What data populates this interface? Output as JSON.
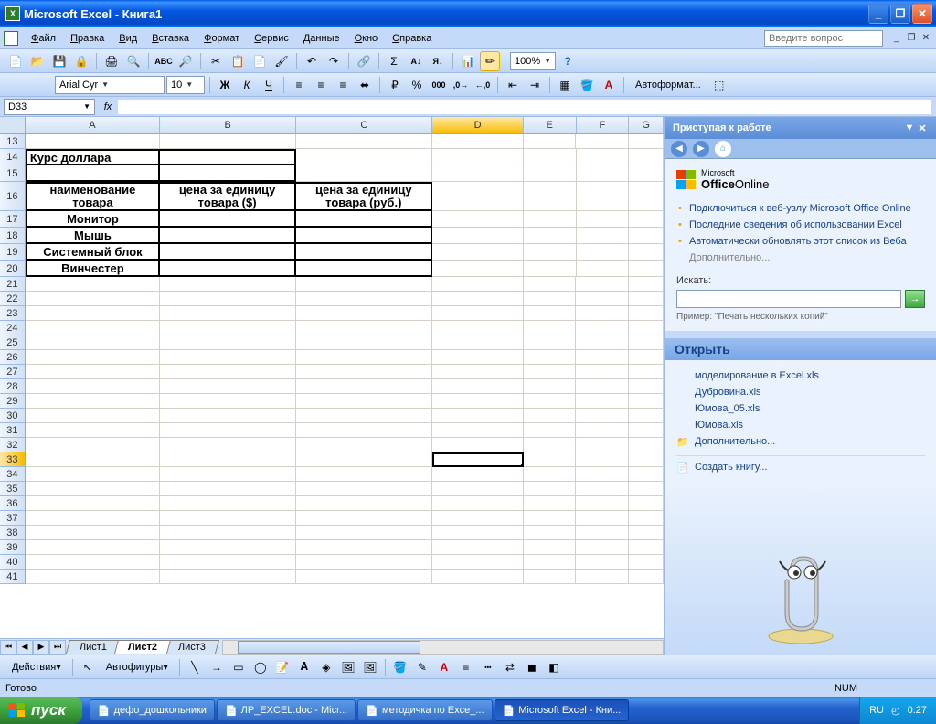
{
  "title": "Microsoft Excel - Книга1",
  "menu": [
    "Файл",
    "Правка",
    "Вид",
    "Вставка",
    "Формат",
    "Сервис",
    "Данные",
    "Окно",
    "Справка"
  ],
  "askbox_placeholder": "Введите вопрос",
  "font_name": "Arial Cyr",
  "font_size": "10",
  "zoom": "100%",
  "autoformat_label": "Автоформат...",
  "namebox": "D33",
  "columns": [
    {
      "id": "A",
      "w": 148
    },
    {
      "id": "B",
      "w": 150
    },
    {
      "id": "C",
      "w": 150
    },
    {
      "id": "D",
      "w": 100
    },
    {
      "id": "E",
      "w": 58
    },
    {
      "id": "F",
      "w": 58
    },
    {
      "id": "G",
      "w": 38
    }
  ],
  "visible_rows_start": 13,
  "visible_rows_end": 41,
  "active_cell": {
    "row": 33,
    "col": "D"
  },
  "cells": {
    "A14": "Курс доллара",
    "A16": "наименование товара",
    "B16": "цена за единицу товара ($)",
    "C16": "цена за единицу товара (руб.)",
    "A17": "Монитор",
    "A18": "Мышь",
    "A19": "Системный блок",
    "A20": "Винчестер"
  },
  "sheets": [
    "Лист1",
    "Лист2",
    "Лист3"
  ],
  "active_sheet": "Лист2",
  "drawing_label": "Действия",
  "autoshapes_label": "Автофигуры",
  "taskpane": {
    "title": "Приступая к работе",
    "office_brand_small": "Microsoft",
    "office_brand_bold": "Office",
    "office_brand_tail": "Online",
    "links": [
      "Подключиться к веб-узлу Microsoft Office Online",
      "Последние сведения об использовании Excel",
      "Автоматически обновлять этот список из Веба"
    ],
    "more": "Дополнительно...",
    "search_label": "Искать:",
    "example": "Пример: \"Печать нескольких копий\"",
    "open_title": "Открыть",
    "recent_files": [
      "моделирование в Excel.xls",
      "Дубровина.xls",
      "Юмова_05.xls",
      "Юмова.xls"
    ],
    "open_more": "Дополнительно...",
    "create": "Создать книгу..."
  },
  "status": "Готово",
  "status_num": "NUM",
  "taskbar": {
    "start": "пуск",
    "items": [
      "дефо_дошкольники",
      "ЛР_EXCEL.doc - Micr...",
      "методичка по Exce_...",
      "Microsoft Excel - Кни..."
    ],
    "active_index": 3,
    "lang": "RU",
    "time": "0:27"
  }
}
